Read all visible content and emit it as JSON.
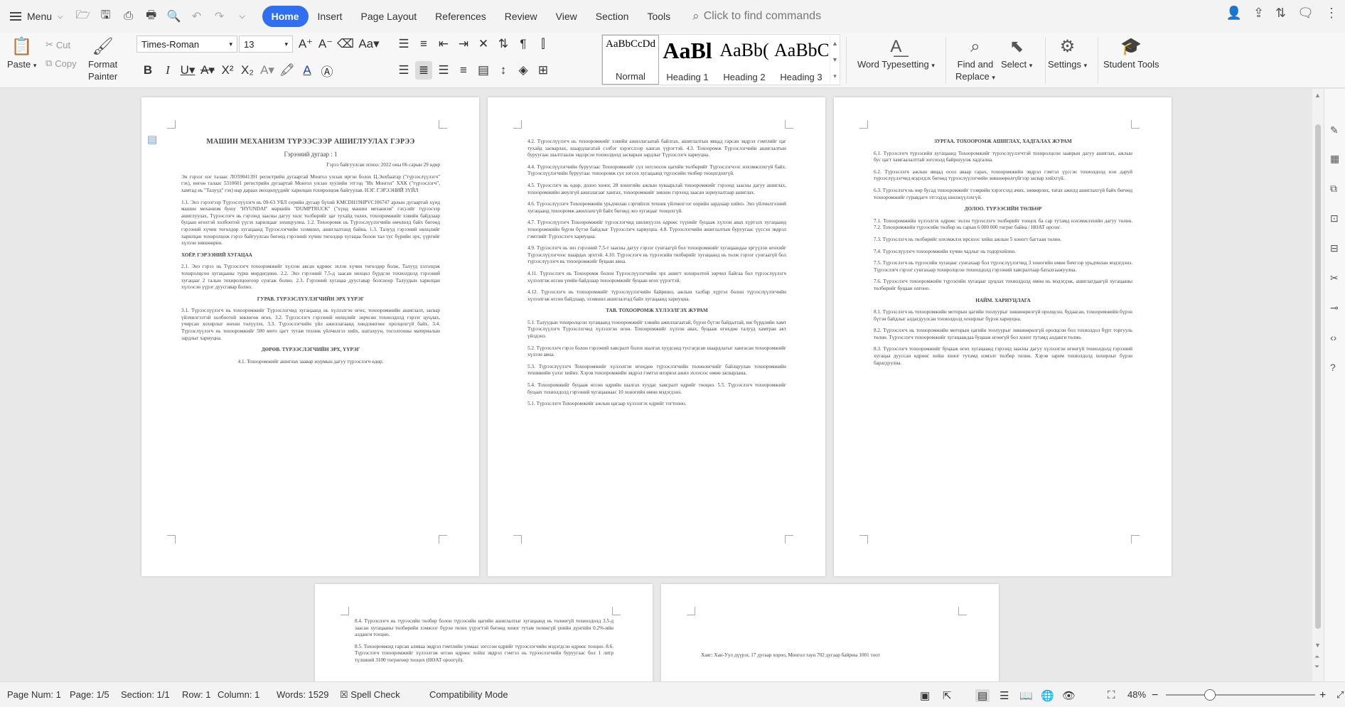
{
  "menubar": {
    "menu_label": "Menu",
    "tabs": [
      "Home",
      "Insert",
      "Page Layout",
      "References",
      "Review",
      "View",
      "Section",
      "Tools"
    ],
    "active_tab": "Home",
    "command_search_placeholder": "Click to find commands"
  },
  "ribbon": {
    "paste": "Paste",
    "cut": "Cut",
    "copy": "Copy",
    "format_painter_l1": "Format",
    "format_painter_l2": "Painter",
    "font_name": "Times-Roman",
    "font_size": "13",
    "styles": [
      {
        "preview": "AaBbCcDd",
        "label": "Normal"
      },
      {
        "preview": "AaBl",
        "label": "Heading 1"
      },
      {
        "preview": "AaBb(",
        "label": "Heading 2"
      },
      {
        "preview": "AaBbC",
        "label": "Heading 3"
      }
    ],
    "word_typesetting": "Word Typesetting",
    "find_replace_l1": "Find and",
    "find_replace_l2": "Replace",
    "select": "Select",
    "settings": "Settings",
    "student_tools": "Student Tools"
  },
  "document": {
    "page1": {
      "title": "МАШИН МЕХАНИЗМ ТҮРЭЭСЭЭР АШИГЛУУЛАХ ГЭРЭЭ",
      "subtitle": "Гэрээний дугаар : 1",
      "date": "Гэрээ байгуулсан огноо: 2022 оны 06 сарын 29 өдөр",
      "intro": "Эн гэрээг нэг талаас ЛО59041391 регистрийн дугаартай Монгол улсын иргэн болох Ц.Энхбаатар (\"түрээслүүлэгч\" гэх), нөгөө талаас 5310601 регистрийн дугаартай Монгол улсын хуулийн этгээд \"Их Монгол\" ХХК (\"түрээслэгч\", хамтад нь \"Талууд\" гэх) нар дараах нөхцөлүүдийг харилцан тохиролцож байгуулав. НЭГ. ГЭРЭЭНИЙ ЗҮЙЛ",
      "s1": "1.1. Энэ гэрээгээр Түрээслүүлэгч нь 09-63 УБЛ серийн дугаар бүхий KMCDH19HPVC106747 арлын дугаартай хүнд машин механизм буюу \"HYUNDAI\" маркийн \"DUMPTRUCK\" (\"хүнд машин механизм\" гэх)-ийг түрээсээр ашиглуулах, Түрээслэгч нь гэрээнд заасны дагуу хөлс төлбөрийг цаг тухайд төлөх, тохооромжийг хэвийн байдлаар буцаан өгөхтэй холбоотой үүсэх харилцааг зохицуулна. 1.2. Тохооромж нь Түрээслүүлэгчийн өмчлөлд байх бөгөөд гэрээний хүчин төгөлдөр хугацаанд Түрээслэгчийн эзэмшил, ашиглалтанд байна. 1.3. Талууд гэрээний нөхцлийг харилцан тохиролцож гэрээ байгуулсан бөгөөд гэрээний хүчин төгөлдөр хугацаа болон тал тус бүрийн эрх, үүргийг хүлээн зөвшөөрнө.",
      "s2_head": "ХОЁР. ГЭРЭЭНИЙ ХУГАЦАА",
      "s2": "2.1. Энэ гэрээ нь Түрээслэгч тохооромжийг хүлээн авсан өдрөөс эхлэн хүчин төгөлдөр болж, Талууд хэлэлцэж тохиролцсон хугацааны турш мөрдөгдөнө. 2.2. Энэ гэрээний 7.5-д заасан нөхцөл бүрдсэн тохиолдолд гэрээний хугацааг 2 талын тохиролцоогоор сунгаж болно. 2.3. Гэрээний хугацаа дуусгавар болсноор Талуудын харилцан хүлээсэн үүрэг дуусгавар болно.",
      "s3_head": "ГУРАВ. ТҮРЭЭСЛҮҮЛЭГЧИЙН ЭРХ ҮҮРЭГ",
      "s3": "3.1. Түрээслүүлэгч нь тохооромжийг Түрээслэгчид хугацаанд нь хүлээлгэн өгөх, тохооромжийн ашиглалт, засвар үйлчилгээтэй холбоотой зөвлөгөө өгөх. 3.2. Түрээслэгч гэрээний нөхцлийг зөрчсөн тохиолдолд гэрээг цуцлах, учирсан хохирлыг нөхөн төлүүлэх. 3.3. Түрээслэгчийн үйл ажиллагаанд хөндлөнгөөс оролцохгүй байх. 3.4. Түрээслүүлэгч нь тохооромжийг 500 мото цагт тутам техник үйлчилгээ хийх, шатахуун, тосолгооны материалын зардлыг хариуцна.",
      "s4_head": "ДӨРӨВ. ТҮРЭЭСЛЭГЧИЙН ЭРХ, ҮҮРЭГ",
      "s4_1": "4.1. Тохооромжийг ашиглах заавар журмын дагуу түрээслэгч өдөр."
    },
    "page2": {
      "s4": "4.2. Түрээслүүлэгч нь тохооромжийг хэвийн ажиллагаатай байлгах, ашиглалтын явцад гарсан эвдрэл гэмтлийг цаг тухайд засварлах, шаардлагатай сэлбэг хэрэгслээр хангах үүрэгтэй. 4.3. Тохооромж Түрээслэгчийн ашиглалтын буруугаас шалтгаалж эвдэрсэн тохиолдолд засварын зардлыг Түрээслэгч хариуцна.",
      "s4_4": "4.4. Түрээслүүлэгчийн буруугаас Тохооромжийг сул зогсоосон цагийн төлбөрийг Түрээслэгчээс нэхэмжлэхгүй байх. Түрээслүүлэгчийн буруугаас тохооромж сул зогсох хугацаанд түрээсийн төлбөр тооцогдохгүй.",
      "s4_5": "4.5. Түрээслэгч нь өдөр, долоо хоног, 28 хоногийн ажлын хуваарьтай тохооромжийг гэрээнд заасны дагуу ашиглах, тохооромжийн аюулгүй ажиллагааг хангах, тохооромжийг зөвхөн гэрээнд заасан зориулалтаар ашиглах.",
      "s4_6": "4.6. Түрээслүүлэгч Тохооромжийн урьдчилан сэргийлэх техник үйлчилгээг оорийн зардлаар хийнэ. Энэ үйлчилгээний хугацаанд тохооромж ажиллахгүй байх бөгөөд энэ хугацааг тооцохгүй.",
      "s4_7": "4.7. Түрээслүүлэгч Тохооромжийг түрээслэгчид шилжүүлэх өдрөөс түүнийг буцааж хүлээн авах хүртэлх хугацаанд тохооромжийн бүрэн бүтэн байдлыг Түрээслэгч хариуцна. 4.8. Түрээслэгчийн ашиглалтын буруугаас үүссэн эвдрэл гэмтлийг Түрээслэгч хариуцна.",
      "s4_9": "4.9. Түрээслэгч нь энэ гэрээний 7.5-т заасны дагуу гэрээг сунгаагүй бол тохооромжийг хугацаандаа эргүүлэн өгөхийг Түрээслүүлэгчээс шаардах эрхтэй. 4.10. Түрээслэгч нь түрээсийн төлбөрийг хугацаанд нь төлж гэрээг сунгаагүй бол түрээслүүлэгч нь тохооромжийг буцаан авна.",
      "s4_11": "4.11. Түрээслэгч нь Тохооромж болон Түрээслүүлэгчийн эрх ашигт хохиролтой зөрчил байгаа бол түрээслүүлэгч хүлээлгэж өгсөн үеийн байдлаар тохооромжийг буцаан өгөх үүрэгтэй.",
      "s4_12": "4.12. Түрээслэгч нь тохооромжийг түрээслүүлэгчийн байршил, ажлын талбар хүртэл болон түрээслүүлэгчийн хүлээлгэж өгсөн байдлаар, эзэмшил ашиглалтад байх хугацаанд хариуцна.",
      "s5_head": "ТАВ. ТОХООРОМЖ ХҮЛЭЭЛГЭХ ЖУРАМ",
      "s5_1": "5.1. Талуудын тохиролцсон хугацаанд тохооромжийг хэвийн ажиллагаатай, бүрэн бүтэн байдалтай, иж бүрдлийн хамт Түрээслүүлэгч Түрээслэгчид хүлээлгэн өгнө. Тохооромжийг хүлээн авах, буцааж өгөхдөө талууд хамтран акт үйлдэнэ.",
      "s5_2": "5.2. Түрээслэгч гэрээ болон гэрээний хавсралт болох шалгах хуудсанд тусгагдсан шаардлагыг хангасан тохооромжийг хүлээн авна.",
      "s5_3": "5.3. Түрээслүүлэгч Тохооромжийг хүлээлгэн өгөхдөө түрээслэгчийн төлөөлөгчийг байлцуулан тохооромжийн техникийн үзлэг хийнэ. Хэрэв тохооромжийн эвдрэл гэмтэл илэрвэл ажил эхлэхээс өмнө засварлана.",
      "s5_4": "5.4. Тохооромжийг буцааж өгсөн өдрийн шалгах хуудас хавсралт өдрийг тооцно. 5.5. Түрээслэгч тохооромжийг буцаах тохиолдолд гэрээний хугацаанаас 10 хоногийн өмнө мэдэгдэнэ.",
      "s5_5": "5.1. Түрээслэгч Тохооромжийг ажлын цагаар хүлээлгэх өдрийг тогтооно."
    },
    "page3": {
      "s6_head": "ЗУРГАА. ТОХООРОМЖ АШИГЛАХ, ХАДГАЛАХ ЖУРАМ",
      "s6_1": "6.1. Түрээслэгч түрээсийн хугацаанд Тохооромжийг түрээслүүлэгчтэй тохиролцсон зааврын дагуу ашиглах, ажлын бус цагт хамгаалалттай зогсоолд байршуулж хадгална.",
      "s6_2": "6.2. Түрээслэгч ажлын явцад осол аваар гарах, тохооромжийн эвдрэл гэмтэл үүссэн тохиолдолд нэн даруй түрээслүүлэгчид мэдэгдэх бөгөөд түрээслүүлэгчийн зөвшөөрөлгүйгээр засвар хийхгүй.",
      "s6_3": "6.3. Түрээслэгч нь өөр бусад тохооромжийг тээврийн хэрэгсэлд ачих, зөөвөрлөх, татах ажилд ашиглахгүй байх бөгөөд тохооромжийг гуравдагч этгээдэд шилжүүлэхгүй.",
      "s7_head": "ДОЛОО. ТҮРЭЭСИЙН ТӨЛБӨР",
      "s7_1": "7.1. Тохооромжийн хүлээлгэх өдрөөс эхлэн түрээслэгч төлбөрийг тооцох ба сар тутамд нэхэмжлэхийн дагуу төлнө. 7.2. Тохооромжийн түрээсийн төлбөр нь сарын 6 000 000 төгрөг байна / НӨАТ орсон/.",
      "s7_3": "7.3. Түрээслэгч нь төлбөрийг нэхэмжлэх ирснээс хойш ажлын 5 хоногт багтаан төлнө.",
      "s7_4": "7.4. Түрээслүүлэгч тохооромжийн хүчин чадлыг нь тодорхойлно.",
      "s7_5": "7.5. Түрээслэгч нь түрээсийн хугацааг сунгахаар бол түрээслүүлэгчид 3 хоногийн өмнө бичгээр урьдчилан мэдэгдэнэ. Түрээслэгч гэрээг сунгахаар тохиролцсон тохиолдолд гэрээний хавсралтаар баталгаажуулна.",
      "s7_6": "7.6. Түрээслэгч тохооромжийн түрээсийн хугацааг цуцлах тохиолдолд өмнө нь мэдэгдэж, ашиглагдаагүй хугацааны төлбөрийг буцаан олгоно.",
      "s8_head": "НАЙМ. ХАРИУЦЛАГА",
      "s8_1": "8.1. Түрээслэгч нь тохооромжийн моторын цагийн тоолуурыг зөвшөөрөлгүй оролцсон, будаасан, тохооромжийн бүрэн бүтэн байдлыг алдагдуулсан тохиолдолд хохирлыг бүрэн хариуцна.",
      "s8_2": "8.2. Түрээслэгч нь тохооромжийн моторын цагийн тоолуурыг зөвшөөрөлгүй оролцсон бол тохиолдол бүрт торгууль төлнө. Түрээслэгч тохооромжийг хугацаандаа буцааж өгөөгүй бол хоног тутамд алданги төлнө.",
      "s8_3": "8.3. Түрээслэгч тохооромжийг буцааж өгөх хугацаанд гэрээнд заасны дагуу хүлээлгэн өгөөгүй тохиолдолд гэрээний хугацаа дууссан өдрөөс хойш хоног тутамд нэмэлт төлбөр төлнө. Хэрэв зарим тохиолдолд хохирлыг бүрэн барагдуулна."
    },
    "page4": {
      "s8_4": "8.4. Түрээслэгч нь түрээсийн төлбөр болон түрээсийн цагийн ашиглалтыг хугацаанд нь төлөөгүй тохиолдолд 3.5-д заасан хугацааны төлбөрийн хэмжээг бүрэн төлөх үүрэгтэй бөгөөд хоног тутам төлөөгүй үнийн дүнгийн 0.2%-ийн алданги тооцно.",
      "s8_5": "8.5. Тохооромжид гарсан аливаа эвдрэл гэмтлийн улмаас зогссон өдрийг түрээслэгчийн мэдэгдсэн өдрөөс тооцно. 8.6. Түрээслэгч тохооромжийг хүлээлгэж өгсөн өдрөөс хойш эвдрэл гэмтэл нь түрээслэгчийн буруугаас бол 1 литр түлшний 3100 төгрөгөөр тооцох (НӨАТ ороогүй)."
    },
    "page5": {
      "address": "Хаяг: Хан-Уул дүүрэг, 17 дугаар хороо, Монгол таун 702 дугаар байрны 1001 тоот"
    }
  },
  "status": {
    "page_num": "Page Num: 1",
    "page": "Page: 1/5",
    "section": "Section: 1/1",
    "row": "Row: 1",
    "column": "Column: 1",
    "words": "Words: 1529",
    "spell_check": "Spell Check",
    "compat": "Compatibility Mode",
    "zoom": "48%"
  }
}
